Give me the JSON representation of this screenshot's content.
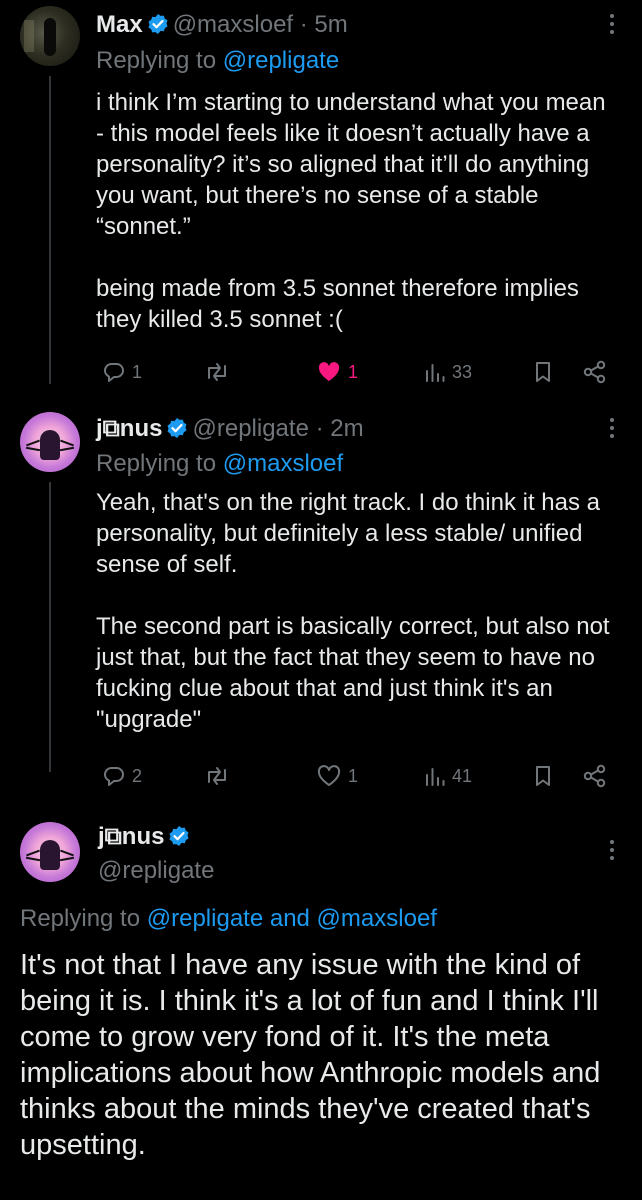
{
  "tweets": [
    {
      "display_name": "Max",
      "handle": "@maxsloef",
      "dot_time": "· 5m",
      "replying_to_label": "Replying to",
      "replying_to": "@repligate",
      "paragraphs": [
        "i think I’m starting to understand what you mean - this model feels like it doesn’t actually have a personality? it’s so aligned that it’ll do anything you want, but there’s no sense of a stable “sonnet.”",
        "being made from 3.5 sonnet therefore implies they killed 3.5 sonnet :("
      ],
      "stats": {
        "replies": "1",
        "likes": "1",
        "views": "33"
      },
      "liked": true
    },
    {
      "display_name": "j⧉nus",
      "handle": "@repligate",
      "dot_time": "· 2m",
      "replying_to_label": "Replying to",
      "replying_to": "@maxsloef",
      "paragraphs": [
        "Yeah, that's on the right track. I do think it has a personality, but definitely a less stable/ unified sense of self.",
        "The second part is basically correct, but also not just that, but the fact that they seem to have no fucking clue about that and just think it's an \"upgrade\""
      ],
      "stats": {
        "replies": "2",
        "likes": "1",
        "views": "41"
      },
      "liked": false
    }
  ],
  "main_tweet": {
    "display_name": "j⧉nus",
    "handle": "@repligate",
    "replying_to_label": "Replying to",
    "replying_to": "@repligate and @maxsloef",
    "text": "It's not that I have any issue with the kind of being it is. I think it's a lot of fun and I think I'll come to grow very fond of it. It's the meta implications about how Anthropic models and thinks about the minds they've created that's upsetting."
  },
  "colors": {
    "background": "#000000",
    "text": "#e7e9ea",
    "muted": "#71767b",
    "link": "#1d9bf0",
    "like": "#f91880"
  },
  "icons": [
    "reply-icon",
    "retweet-icon",
    "heart-icon",
    "views-icon",
    "bookmark-icon",
    "share-icon",
    "verified-icon",
    "more-icon"
  ]
}
